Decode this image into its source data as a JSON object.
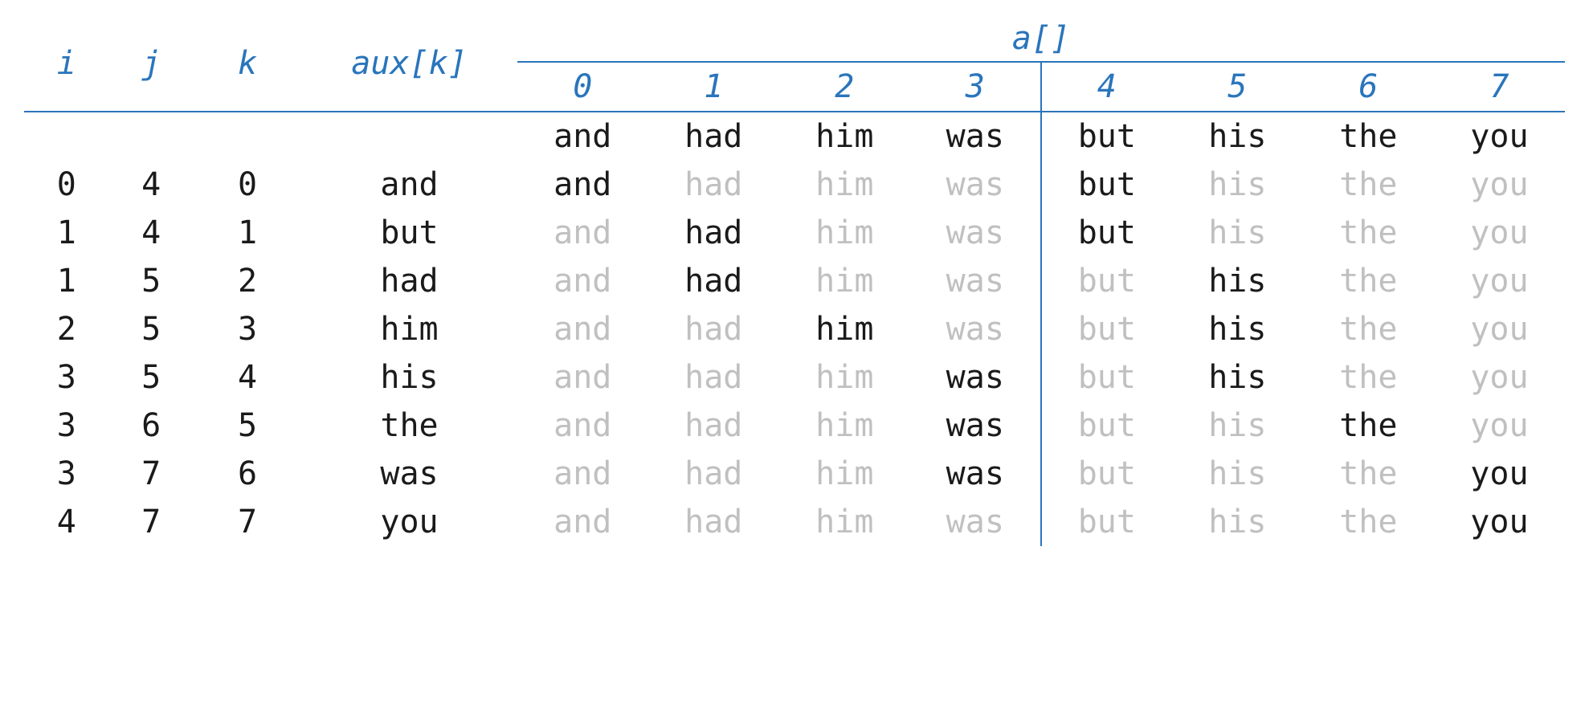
{
  "headers": {
    "i": "i",
    "j": "j",
    "k": "k",
    "aux": "aux[k]",
    "a": "a[]",
    "indices": [
      "0",
      "1",
      "2",
      "3",
      "4",
      "5",
      "6",
      "7"
    ]
  },
  "split_after_index": 3,
  "rows": [
    {
      "i": "",
      "j": "",
      "k": "",
      "aux": "",
      "a": [
        {
          "t": "and",
          "dim": false
        },
        {
          "t": "had",
          "dim": false
        },
        {
          "t": "him",
          "dim": false
        },
        {
          "t": "was",
          "dim": false
        },
        {
          "t": "but",
          "dim": false
        },
        {
          "t": "his",
          "dim": false
        },
        {
          "t": "the",
          "dim": false
        },
        {
          "t": "you",
          "dim": false
        }
      ]
    },
    {
      "i": "0",
      "j": "4",
      "k": "0",
      "aux": "and",
      "a": [
        {
          "t": "and",
          "dim": false
        },
        {
          "t": "had",
          "dim": true
        },
        {
          "t": "him",
          "dim": true
        },
        {
          "t": "was",
          "dim": true
        },
        {
          "t": "but",
          "dim": false
        },
        {
          "t": "his",
          "dim": true
        },
        {
          "t": "the",
          "dim": true
        },
        {
          "t": "you",
          "dim": true
        }
      ]
    },
    {
      "i": "1",
      "j": "4",
      "k": "1",
      "aux": "but",
      "a": [
        {
          "t": "and",
          "dim": true
        },
        {
          "t": "had",
          "dim": false
        },
        {
          "t": "him",
          "dim": true
        },
        {
          "t": "was",
          "dim": true
        },
        {
          "t": "but",
          "dim": false
        },
        {
          "t": "his",
          "dim": true
        },
        {
          "t": "the",
          "dim": true
        },
        {
          "t": "you",
          "dim": true
        }
      ]
    },
    {
      "i": "1",
      "j": "5",
      "k": "2",
      "aux": "had",
      "a": [
        {
          "t": "and",
          "dim": true
        },
        {
          "t": "had",
          "dim": false
        },
        {
          "t": "him",
          "dim": true
        },
        {
          "t": "was",
          "dim": true
        },
        {
          "t": "but",
          "dim": true
        },
        {
          "t": "his",
          "dim": false
        },
        {
          "t": "the",
          "dim": true
        },
        {
          "t": "you",
          "dim": true
        }
      ]
    },
    {
      "i": "2",
      "j": "5",
      "k": "3",
      "aux": "him",
      "a": [
        {
          "t": "and",
          "dim": true
        },
        {
          "t": "had",
          "dim": true
        },
        {
          "t": "him",
          "dim": false
        },
        {
          "t": "was",
          "dim": true
        },
        {
          "t": "but",
          "dim": true
        },
        {
          "t": "his",
          "dim": false
        },
        {
          "t": "the",
          "dim": true
        },
        {
          "t": "you",
          "dim": true
        }
      ]
    },
    {
      "i": "3",
      "j": "5",
      "k": "4",
      "aux": "his",
      "a": [
        {
          "t": "and",
          "dim": true
        },
        {
          "t": "had",
          "dim": true
        },
        {
          "t": "him",
          "dim": true
        },
        {
          "t": "was",
          "dim": false
        },
        {
          "t": "but",
          "dim": true
        },
        {
          "t": "his",
          "dim": false
        },
        {
          "t": "the",
          "dim": true
        },
        {
          "t": "you",
          "dim": true
        }
      ]
    },
    {
      "i": "3",
      "j": "6",
      "k": "5",
      "aux": "the",
      "a": [
        {
          "t": "and",
          "dim": true
        },
        {
          "t": "had",
          "dim": true
        },
        {
          "t": "him",
          "dim": true
        },
        {
          "t": "was",
          "dim": false
        },
        {
          "t": "but",
          "dim": true
        },
        {
          "t": "his",
          "dim": true
        },
        {
          "t": "the",
          "dim": false
        },
        {
          "t": "you",
          "dim": true
        }
      ]
    },
    {
      "i": "3",
      "j": "7",
      "k": "6",
      "aux": "was",
      "a": [
        {
          "t": "and",
          "dim": true
        },
        {
          "t": "had",
          "dim": true
        },
        {
          "t": "him",
          "dim": true
        },
        {
          "t": "was",
          "dim": false
        },
        {
          "t": "but",
          "dim": true
        },
        {
          "t": "his",
          "dim": true
        },
        {
          "t": "the",
          "dim": true
        },
        {
          "t": "you",
          "dim": false
        }
      ]
    },
    {
      "i": "4",
      "j": "7",
      "k": "7",
      "aux": "you",
      "a": [
        {
          "t": "and",
          "dim": true
        },
        {
          "t": "had",
          "dim": true
        },
        {
          "t": "him",
          "dim": true
        },
        {
          "t": "was",
          "dim": true
        },
        {
          "t": "but",
          "dim": true
        },
        {
          "t": "his",
          "dim": true
        },
        {
          "t": "the",
          "dim": true
        },
        {
          "t": "you",
          "dim": false
        }
      ]
    }
  ]
}
